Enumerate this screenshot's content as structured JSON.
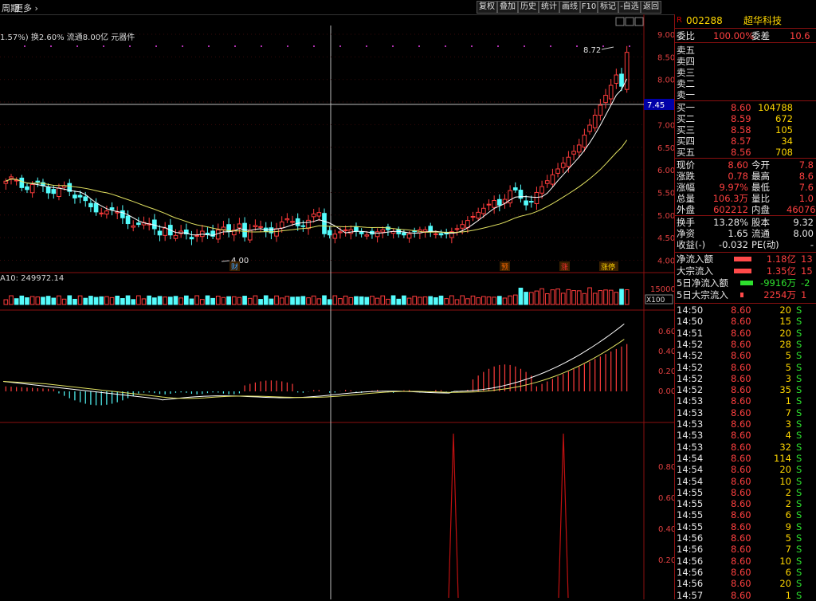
{
  "toolbar": {
    "left_label": "周期",
    "more_label": "更多",
    "buttons": [
      "复权",
      "叠加",
      "历史",
      "统计",
      "画线",
      "F10",
      "标记",
      "-自选",
      "返回"
    ]
  },
  "stock": {
    "code": "002288",
    "name": "超华科技",
    "prefix": "R"
  },
  "main_chart": {
    "info_line": "1.57%) 换2.60% 流通8.00亿 元器件",
    "high_label": "8.72",
    "low_label": "4.00",
    "cursor_price": "7.45",
    "yaxis_labels": [
      "9.00",
      "8.50",
      "8.00",
      "7.50",
      "7.00",
      "6.50",
      "6.00",
      "5.50",
      "5.00",
      "4.50",
      "4.00"
    ],
    "event_tags": [
      {
        "text": "财",
        "color": "#3aa0ff"
      },
      {
        "text": "预",
        "color": "#ff6a00"
      },
      {
        "text": "涨",
        "color": "#ff3030"
      },
      {
        "text": "涨停",
        "color": "#ffd400"
      }
    ]
  },
  "volume_chart": {
    "ma_label": "A10: 249972.14",
    "yaxis_top": "15000",
    "unit": "X100"
  },
  "macd_chart": {
    "yaxis_labels": [
      "0.60",
      "0.40",
      "0.20",
      "0.00"
    ]
  },
  "signal_chart": {
    "yaxis_labels": [
      "0.80",
      "0.60",
      "0.40",
      "0.20"
    ]
  },
  "order_book": {
    "wei_bi_label": "委比",
    "wei_bi": "100.00%",
    "wei_cha_label": "委差",
    "wei_cha": "10.6",
    "sells": [
      {
        "label": "卖五"
      },
      {
        "label": "卖四"
      },
      {
        "label": "卖三"
      },
      {
        "label": "卖二"
      },
      {
        "label": "卖一"
      }
    ],
    "buys": [
      {
        "label": "买一",
        "price": "8.60",
        "vol": "104788"
      },
      {
        "label": "买二",
        "price": "8.59",
        "vol": "672"
      },
      {
        "label": "买三",
        "price": "8.58",
        "vol": "105"
      },
      {
        "label": "买四",
        "price": "8.57",
        "vol": "34"
      },
      {
        "label": "买五",
        "price": "8.56",
        "vol": "708"
      }
    ]
  },
  "quote": [
    {
      "l1": "现价",
      "v1": "8.60",
      "l2": "今开",
      "v2": "7.8"
    },
    {
      "l1": "涨跌",
      "v1": "0.78",
      "l2": "最高",
      "v2": "8.6"
    },
    {
      "l1": "涨幅",
      "v1": "9.97%",
      "l2": "最低",
      "v2": "7.6"
    },
    {
      "l1": "总量",
      "v1": "106.3万",
      "l2": "量比",
      "v2": "1.0"
    },
    {
      "l1": "外盘",
      "v1": "602212",
      "l2": "内盘",
      "v2": "46076"
    }
  ],
  "fund": [
    {
      "l1": "换手",
      "v1": "13.28%",
      "l2": "股本",
      "v2": "9.32"
    },
    {
      "l1": "净资",
      "v1": "1.65",
      "l2": "流通",
      "v2": "8.00"
    },
    {
      "l1": "收益(-)",
      "v1": "-0.032",
      "l2": "PE(动)",
      "v2": "-"
    }
  ],
  "flows": [
    {
      "label": "净流入额",
      "value": "1.18亿",
      "extra": "13"
    },
    {
      "label": "大宗流入",
      "value": "1.35亿",
      "extra": "15"
    },
    {
      "label": "5日净流入额",
      "value": "-9916万",
      "extra": "-2"
    },
    {
      "label": "5日大宗流入",
      "value": "2254万",
      "extra": "1"
    }
  ],
  "ticks": [
    {
      "t": "14:50",
      "p": "8.60",
      "v": "20",
      "s": "S"
    },
    {
      "t": "14:50",
      "p": "8.60",
      "v": "15",
      "s": "S"
    },
    {
      "t": "14:51",
      "p": "8.60",
      "v": "20",
      "s": "S"
    },
    {
      "t": "14:52",
      "p": "8.60",
      "v": "28",
      "s": "S"
    },
    {
      "t": "14:52",
      "p": "8.60",
      "v": "5",
      "s": "S"
    },
    {
      "t": "14:52",
      "p": "8.60",
      "v": "5",
      "s": "S"
    },
    {
      "t": "14:52",
      "p": "8.60",
      "v": "3",
      "s": "S"
    },
    {
      "t": "14:52",
      "p": "8.60",
      "v": "35",
      "s": "S"
    },
    {
      "t": "14:53",
      "p": "8.60",
      "v": "1",
      "s": "S"
    },
    {
      "t": "14:53",
      "p": "8.60",
      "v": "7",
      "s": "S"
    },
    {
      "t": "14:53",
      "p": "8.60",
      "v": "3",
      "s": "S"
    },
    {
      "t": "14:53",
      "p": "8.60",
      "v": "4",
      "s": "S"
    },
    {
      "t": "14:53",
      "p": "8.60",
      "v": "32",
      "s": "S"
    },
    {
      "t": "14:54",
      "p": "8.60",
      "v": "114",
      "s": "S"
    },
    {
      "t": "14:54",
      "p": "8.60",
      "v": "20",
      "s": "S"
    },
    {
      "t": "14:54",
      "p": "8.60",
      "v": "10",
      "s": "S"
    },
    {
      "t": "14:55",
      "p": "8.60",
      "v": "2",
      "s": "S"
    },
    {
      "t": "14:55",
      "p": "8.60",
      "v": "2",
      "s": "S"
    },
    {
      "t": "14:55",
      "p": "8.60",
      "v": "6",
      "s": "S"
    },
    {
      "t": "14:55",
      "p": "8.60",
      "v": "9",
      "s": "S"
    },
    {
      "t": "14:56",
      "p": "8.60",
      "v": "5",
      "s": "S"
    },
    {
      "t": "14:56",
      "p": "8.60",
      "v": "7",
      "s": "S"
    },
    {
      "t": "14:56",
      "p": "8.60",
      "v": "10",
      "s": "S"
    },
    {
      "t": "14:56",
      "p": "8.60",
      "v": "6",
      "s": "S"
    },
    {
      "t": "14:56",
      "p": "8.60",
      "v": "20",
      "s": "S"
    },
    {
      "t": "14:57",
      "p": "8.60",
      "v": "1",
      "s": "S"
    }
  ],
  "colors": {
    "up": "#ff3c3c",
    "down": "#54fcfc",
    "ma5": "#ffffff",
    "ma10": "#e0e060",
    "border": "#8a1010",
    "cursor": "#0000a8"
  }
}
